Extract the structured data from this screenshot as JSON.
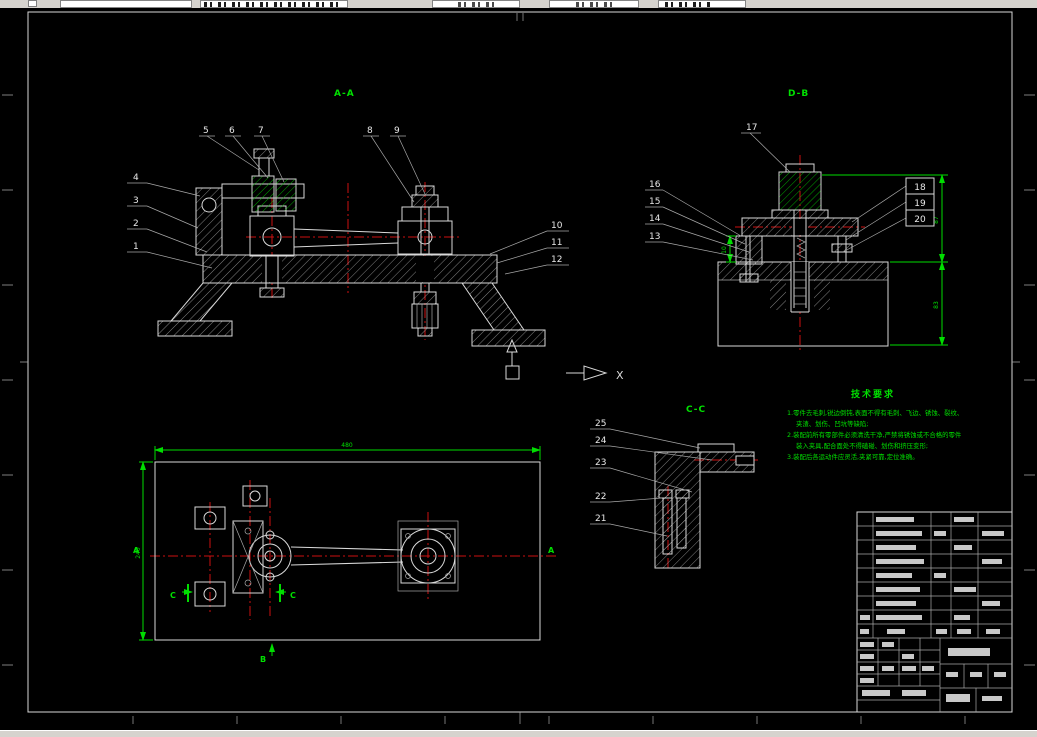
{
  "window": {
    "toolbar": {
      "fields": [
        "",
        "",
        "",
        "",
        ""
      ]
    }
  },
  "drawing": {
    "section_labels": {
      "aa": "A-A",
      "db": "D-B",
      "cc": "C-C"
    },
    "axis_x_label": "X",
    "tech_requirements": {
      "title": "技术要求",
      "lines": [
        "1.零件去毛刺,锐边倒钝,表面不得有毛刺、飞边、锈蚀、裂纹、",
        "夹渣、划伤、凹坑等缺陷;",
        "2.装配前所有零部件必须清洗干净,严禁将锈蚀或不合格的零件",
        "装入夹具,配合面处不得磕碰、划伤和挤压变形;",
        "3.装配后各运动件应灵活,夹紧可靠,定位准确。"
      ]
    },
    "callouts": {
      "n1": "1",
      "n2": "2",
      "n3": "3",
      "n4": "4",
      "n5": "5",
      "n6": "6",
      "n7": "7",
      "n8": "8",
      "n9": "9",
      "n10": "10",
      "n11": "11",
      "n12": "12",
      "n13": "13",
      "n14": "14",
      "n15": "15",
      "n16": "16",
      "n17": "17",
      "n18": "18",
      "n19": "19",
      "n20": "20",
      "n21": "21",
      "n22": "22",
      "n23": "23",
      "n24": "24",
      "n25": "25"
    },
    "dimensions": {
      "plan_width": "480",
      "plan_height": "240",
      "db_upper": "87",
      "db_lower": "83",
      "db_small": "10"
    },
    "view_marks": {
      "c_left": "C",
      "c_right": "C",
      "b": "B",
      "a_left": "A",
      "a_right": "A"
    }
  }
}
